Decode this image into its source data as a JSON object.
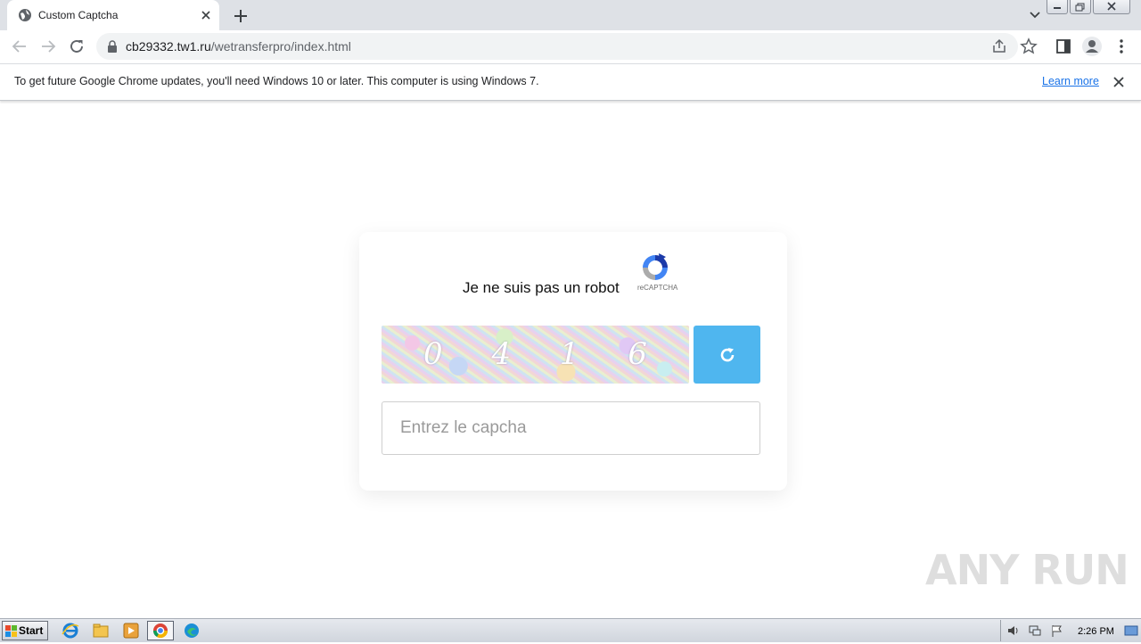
{
  "browser": {
    "tab": {
      "title": "Custom Captcha"
    },
    "omnibox": {
      "host": "cb29332.tw1.ru",
      "path": "/wetransferpro/index.html"
    }
  },
  "infobar": {
    "message": "To get future Google Chrome updates, you'll need Windows 10 or later. This computer is using Windows 7.",
    "learn_more": "Learn more"
  },
  "page": {
    "robot_label": "Je ne suis pas un robot",
    "recaptcha_label": "reCAPTCHA",
    "captcha_code": "0 4 1 6",
    "captcha_placeholder": "Entrez le capcha",
    "refresh_color": "#4fb6ef"
  },
  "watermark": "ANY RUN",
  "taskbar": {
    "start_label": "Start",
    "clock": "2:26 PM",
    "pinned": [
      "internet-explorer-icon",
      "file-explorer-icon",
      "media-player-icon",
      "chrome-icon",
      "edge-icon"
    ]
  }
}
